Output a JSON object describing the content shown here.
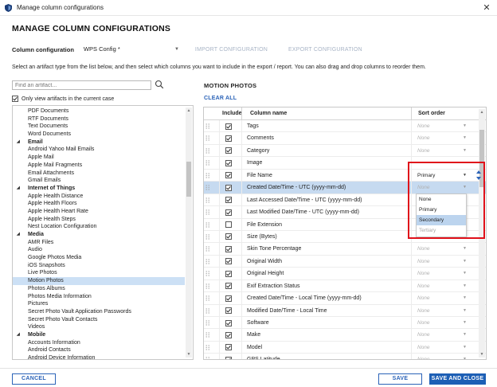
{
  "window": {
    "title": "Manage column configurations",
    "close_glyph": "✕"
  },
  "heading": "MANAGE COLUMN CONFIGURATIONS",
  "config": {
    "label": "Column configuration",
    "selected": "WPS Config *",
    "import_label": "IMPORT CONFIGURATION",
    "export_label": "EXPORT CONFIGURATION"
  },
  "instructions": "Select an artifact type from the list below, and then select which columns you want to include in the export / report. You can also drag and drop columns to reorder them.",
  "search": {
    "placeholder": "Find an artifact..."
  },
  "only_view": {
    "label": "Only view artifacts in the current case",
    "checked": true
  },
  "artifacts": [
    {
      "label": "PDF Documents",
      "type": "child"
    },
    {
      "label": "RTF Documents",
      "type": "child"
    },
    {
      "label": "Text Documents",
      "type": "child"
    },
    {
      "label": "Word Documents",
      "type": "child"
    },
    {
      "label": "Email",
      "type": "group"
    },
    {
      "label": "Android Yahoo Mail Emails",
      "type": "child"
    },
    {
      "label": "Apple Mail",
      "type": "child"
    },
    {
      "label": "Apple Mail Fragments",
      "type": "child"
    },
    {
      "label": "Email Attachments",
      "type": "child"
    },
    {
      "label": "Gmail Emails",
      "type": "child"
    },
    {
      "label": "Internet of Things",
      "type": "group"
    },
    {
      "label": "Apple Health Distance",
      "type": "child"
    },
    {
      "label": "Apple Health Floors",
      "type": "child"
    },
    {
      "label": "Apple Health Heart Rate",
      "type": "child"
    },
    {
      "label": "Apple Health Steps",
      "type": "child"
    },
    {
      "label": "Nest Location Configuration",
      "type": "child"
    },
    {
      "label": "Media",
      "type": "group"
    },
    {
      "label": "AMR Files",
      "type": "child"
    },
    {
      "label": "Audio",
      "type": "child"
    },
    {
      "label": "Google Photos Media",
      "type": "child"
    },
    {
      "label": "iOS Snapshots",
      "type": "child"
    },
    {
      "label": "Live Photos",
      "type": "child"
    },
    {
      "label": "Motion Photos",
      "type": "child",
      "selected": true
    },
    {
      "label": "Photos Albums",
      "type": "child"
    },
    {
      "label": "Photos Media Information",
      "type": "child"
    },
    {
      "label": "Pictures",
      "type": "child"
    },
    {
      "label": "Secret Photo Vault Application Passwords",
      "type": "child"
    },
    {
      "label": "Secret Photo Vault Contacts",
      "type": "child"
    },
    {
      "label": "Videos",
      "type": "child"
    },
    {
      "label": "Mobile",
      "type": "group"
    },
    {
      "label": "Accounts Information",
      "type": "child"
    },
    {
      "label": "Android Contacts",
      "type": "child"
    },
    {
      "label": "Android Device Information",
      "type": "child"
    }
  ],
  "section_title": "MOTION PHOTOS",
  "clear_all": "CLEAR ALL",
  "table": {
    "headers": {
      "include": "Include",
      "column_name": "Column name",
      "sort_order": "Sort order"
    },
    "rows": [
      {
        "name": "Tags",
        "checked": true,
        "sort": "None"
      },
      {
        "name": "Comments",
        "checked": true,
        "sort": "None"
      },
      {
        "name": "Category",
        "checked": true,
        "sort": "None"
      },
      {
        "name": "Image",
        "checked": true,
        "sort": ""
      },
      {
        "name": "File Name",
        "checked": true,
        "sort": "Primary",
        "active": true
      },
      {
        "name": "Created Date/Time - UTC (yyyy-mm-dd)",
        "checked": true,
        "sort": "None",
        "highlight": true
      },
      {
        "name": "Last Accessed Date/Time - UTC (yyyy-mm-dd)",
        "checked": true,
        "sort": ""
      },
      {
        "name": "Last Modified Date/Time - UTC (yyyy-mm-dd)",
        "checked": true,
        "sort": ""
      },
      {
        "name": "File Extension",
        "checked": false,
        "sort": ""
      },
      {
        "name": "Size (Bytes)",
        "checked": true,
        "sort": ""
      },
      {
        "name": "Skin Tone Percentage",
        "checked": true,
        "sort": "None"
      },
      {
        "name": "Original Width",
        "checked": true,
        "sort": "None"
      },
      {
        "name": "Original Height",
        "checked": true,
        "sort": "None"
      },
      {
        "name": "Exif Extraction Status",
        "checked": true,
        "sort": "None"
      },
      {
        "name": "Created Date/Time - Local Time (yyyy-mm-dd)",
        "checked": true,
        "sort": "None"
      },
      {
        "name": "Modified Date/Time - Local Time",
        "checked": true,
        "sort": "None"
      },
      {
        "name": "Software",
        "checked": true,
        "sort": "None"
      },
      {
        "name": "Make",
        "checked": true,
        "sort": "None"
      },
      {
        "name": "Model",
        "checked": true,
        "sort": "None"
      },
      {
        "name": "GPS Latitude",
        "checked": true,
        "sort": "None"
      }
    ]
  },
  "sort_dropdown": {
    "options": [
      {
        "label": "None"
      },
      {
        "label": "Primary"
      },
      {
        "label": "Secondary",
        "hover": true
      },
      {
        "label": "Tertiary",
        "disabled": true
      }
    ]
  },
  "footer": {
    "cancel": "CANCEL",
    "save": "SAVE",
    "save_close": "SAVE AND CLOSE"
  },
  "colors": {
    "accent": "#1d5fb5",
    "link": "#2b63b8",
    "highlight_row": "#c6daf0",
    "selected_item": "#cce0f5",
    "callout": "#e0101a"
  }
}
